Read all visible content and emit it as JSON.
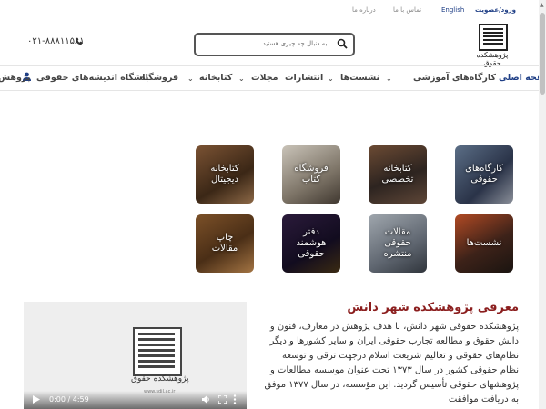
{
  "topbar": {
    "login": "ورود/عضویت",
    "english": "English",
    "contact": "تماس با ما",
    "about": "درباره ما"
  },
  "header": {
    "logo_text": "پژوهشکده حقوق",
    "search_placeholder": "به دنبال چه چیزی هستید...",
    "phone": "۰۲۱-۸۸۸۱۱۵۸۱",
    "search_icon": "search-icon",
    "phone_icon": "phone-icon"
  },
  "nav": {
    "home": "صفحه اصلی",
    "workshops": "کارگاه‌های آموزشی",
    "sessions": "نشست‌ها",
    "publications": "انتشارات",
    "journals": "مجلات",
    "library": "کتابخانه",
    "store": "فروشگاه",
    "club": "باشگاه اندیشه‌های حقوقی",
    "researchers": "پژوهش",
    "user_icon": "user-icon"
  },
  "tiles": [
    {
      "label": "کارگاه‌های\nحقوقی"
    },
    {
      "label": "کتابخانه\nتخصصی"
    },
    {
      "label": "فروشگاه\nکتاب"
    },
    {
      "label": "کتابخانه\nدیجیتال"
    },
    {
      "label": "نشست‌ها"
    },
    {
      "label": "مقالات\nحقوقی\nمنتشره"
    },
    {
      "label": "دفتر\nهوشمند\nحقوقی"
    },
    {
      "label": "چاپ\nمقالات"
    }
  ],
  "intro": {
    "title": "معرفی پژوهشکده شهر دانش",
    "text": "پژوهشکده حقوقی شهر دانش، با هدف پژوهش در معارف، فنون و دانش حقوق و مطالعه تجارب حقوقی ایران و سایر کشورها و دیگر نظام‌های حقوقی و تعالیم شریعت اسلام درجهت ترقی و توسعه نظام حقوقی کشور در سال ۱۳۷۳ تحت عنوان موسسه مطالعات و پژوهشهای حقوقی تأسیس گردید. این مؤسسه، در سال ۱۳۷۷ موفق به دریافت موافقت"
  },
  "video": {
    "time": "0:00 / 4:59",
    "logo_text": "پژوهشکده حقوق",
    "url": "www.sdil.ac.ir",
    "play_icon": "play-icon",
    "volume_icon": "volume-icon",
    "fullscreen_icon": "fullscreen-icon",
    "more_icon": "more-options-icon"
  },
  "colors": {
    "accent": "#1f3f86",
    "title": "#8b1e1e"
  }
}
